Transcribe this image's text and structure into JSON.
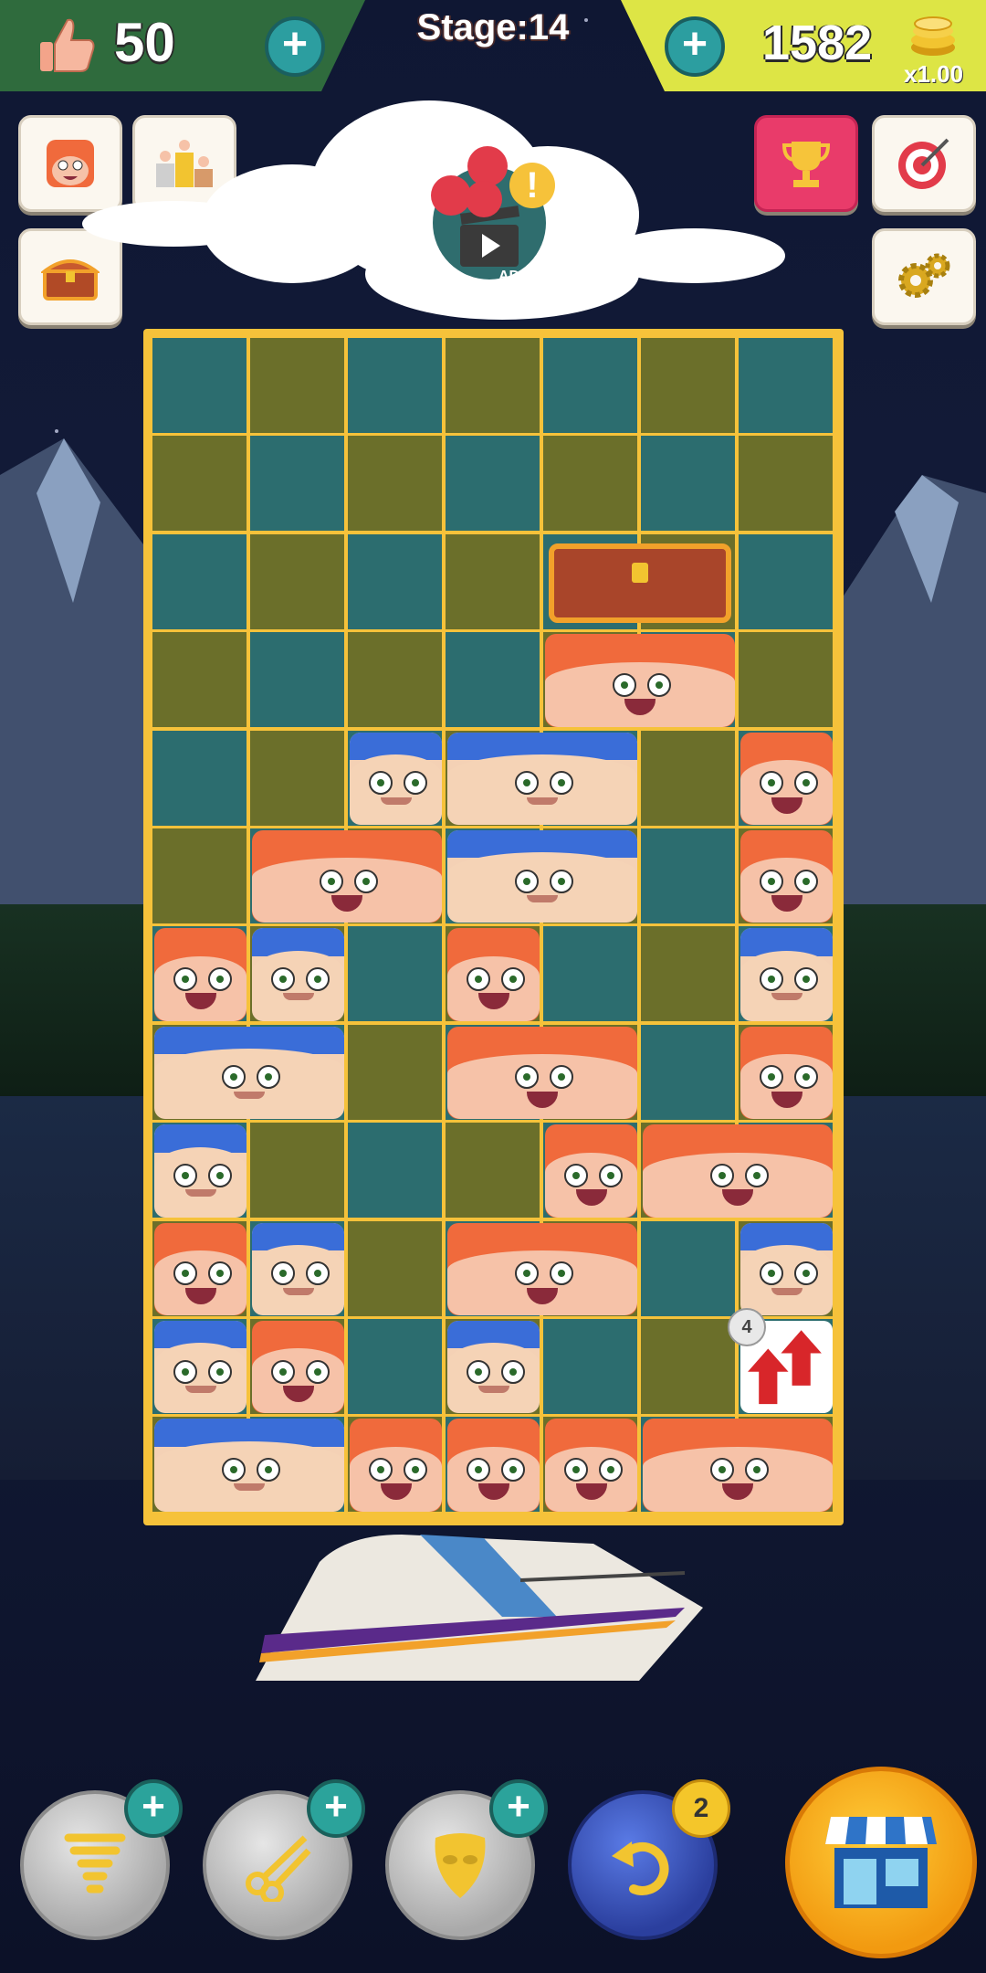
{
  "top_bar": {
    "likes_count": "50",
    "stage_label": "Stage:14",
    "coins_count": "1582",
    "coin_multiplier": "x1.00",
    "add_likes_label": "+",
    "add_coins_label": "+"
  },
  "side_buttons": {
    "left": [
      "profile-icon",
      "leaderboard-icon",
      "treasure-chest-icon"
    ],
    "right": [
      "trophy-icon",
      "target-icon",
      "settings-gear-icon"
    ]
  },
  "ad_button": {
    "label": "AD",
    "icon": "clapperboard-icon",
    "alert": "!"
  },
  "board": {
    "rows": 12,
    "cols": 7,
    "checker_colors": {
      "teal": "#2c6d6f",
      "olive": "#6b6f2a"
    },
    "frame_color": "#f6c23a",
    "arrow_tile_badge": "4"
  },
  "tools": [
    {
      "name": "tornado-tool",
      "icon": "tornado-icon",
      "plus": "+"
    },
    {
      "name": "scissors-tool",
      "icon": "scissors-icon",
      "plus": "+"
    },
    {
      "name": "mask-tool",
      "icon": "mask-icon",
      "plus": "+"
    }
  ],
  "undo": {
    "count": "2",
    "icon": "undo-icon"
  },
  "shop": {
    "icon": "shop-icon"
  }
}
